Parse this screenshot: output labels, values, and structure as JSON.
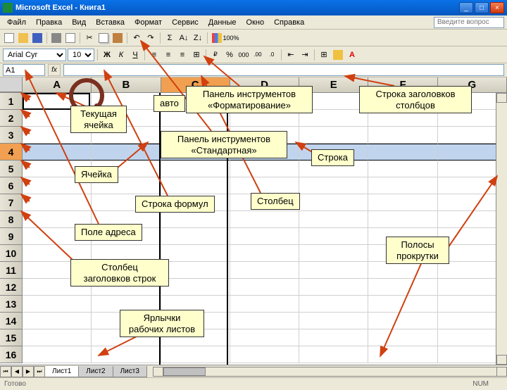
{
  "titlebar": {
    "title": "Microsoft Excel - Книга1"
  },
  "menu": {
    "items": [
      "Файл",
      "Правка",
      "Вид",
      "Вставка",
      "Формат",
      "Сервис",
      "Данные",
      "Окно",
      "Справка"
    ]
  },
  "help_placeholder": "Введите вопрос",
  "formatting": {
    "font": "Arial Cyr",
    "size": "10"
  },
  "namebox": "A1",
  "columns": [
    "A",
    "B",
    "C",
    "D",
    "E",
    "F",
    "G"
  ],
  "rows": [
    "1",
    "2",
    "3",
    "4",
    "5",
    "6",
    "7",
    "8",
    "9",
    "10",
    "11",
    "12",
    "13",
    "14",
    "15",
    "16"
  ],
  "sheets": [
    "Лист1",
    "Лист2",
    "Лист3"
  ],
  "status": {
    "left": "Готово",
    "right": "NUM"
  },
  "callouts": {
    "current_cell": "Текущая\nячейка",
    "autofill": "авто",
    "fmt_toolbar": "Панель инструментов\n«Форматирование»",
    "col_headers": "Строка заголовков\nстолбцов",
    "std_toolbar": "Панель инструментов\n«Стандартная»",
    "row": "Строка",
    "cell": "Ячейка",
    "formula_bar": "Строка формул",
    "column": "Столбец",
    "addr_field": "Поле адреса",
    "scrollbars": "Полосы\nпрокрутки",
    "row_headers": "Столбец\nзаголовков строк",
    "sheet_tabs": "Ярлычки\nрабочих листов"
  }
}
